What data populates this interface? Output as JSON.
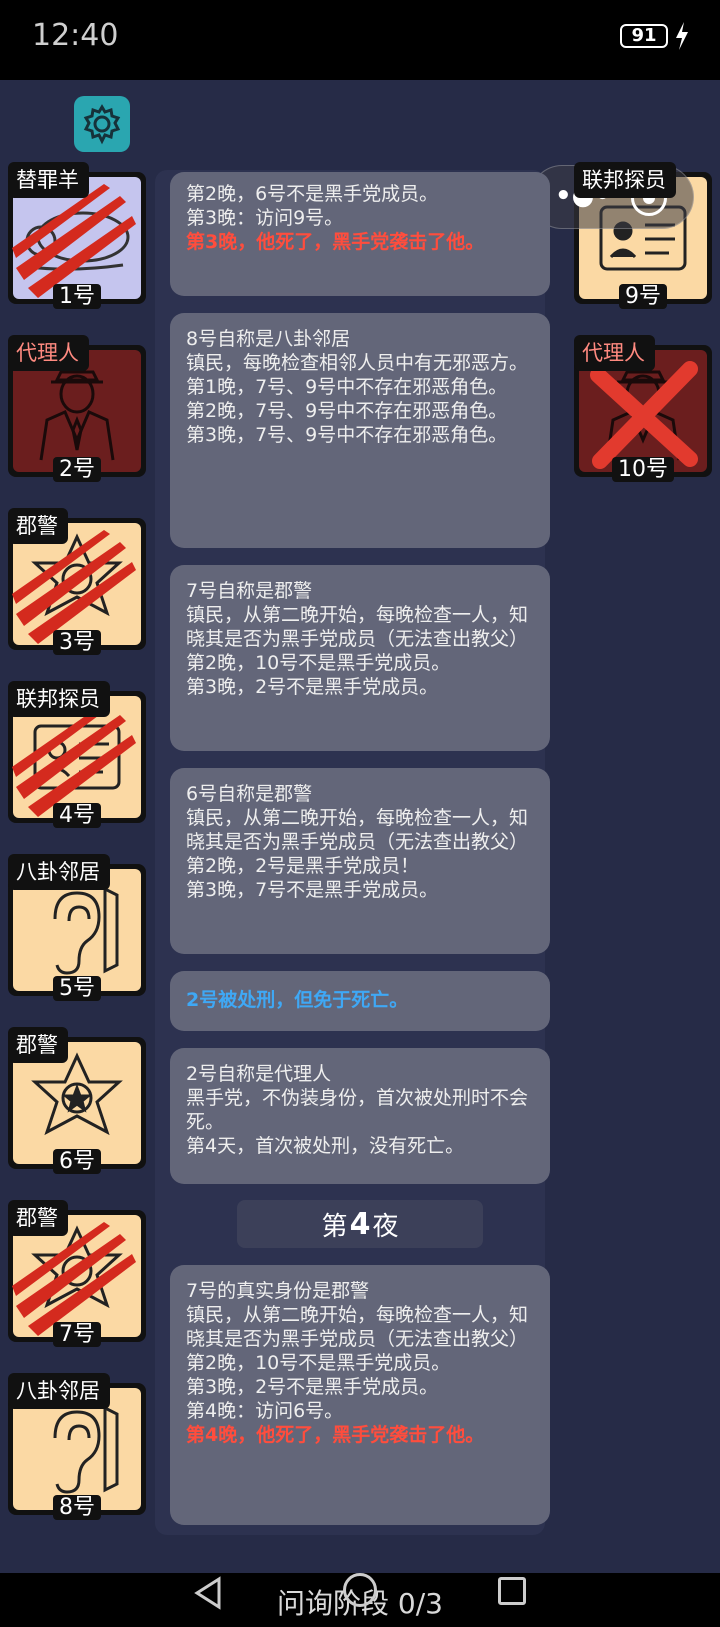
{
  "status": {
    "time": "12:40",
    "battery": "91"
  },
  "players": [
    {
      "role": "替罪羊",
      "num": "1号",
      "icon": "sleeping-sheep-icon",
      "evil": false,
      "dead": true,
      "face": "lilac"
    },
    {
      "role": "代理人",
      "num": "2号",
      "icon": "agent-suit-icon",
      "evil": true,
      "dead": false,
      "face": "dark"
    },
    {
      "role": "郡警",
      "num": "3号",
      "icon": "sheriff-badge-icon",
      "evil": false,
      "dead": true,
      "face": "light"
    },
    {
      "role": "联邦探员",
      "num": "4号",
      "icon": "fbi-card-icon",
      "evil": false,
      "dead": true,
      "face": "light"
    },
    {
      "role": "八卦邻居",
      "num": "5号",
      "icon": "ear-icon",
      "evil": false,
      "dead": false,
      "face": "light"
    },
    {
      "role": "郡警",
      "num": "6号",
      "icon": "sheriff-badge-icon",
      "evil": false,
      "dead": false,
      "face": "light"
    },
    {
      "role": "郡警",
      "num": "7号",
      "icon": "sheriff-badge-icon",
      "evil": false,
      "dead": true,
      "face": "light"
    },
    {
      "role": "八卦邻居",
      "num": "8号",
      "icon": "ear-icon",
      "evil": false,
      "dead": false,
      "face": "light"
    },
    {
      "role": "联邦探员",
      "num": "9号",
      "icon": "fbi-card-icon",
      "evil": false,
      "dead": false,
      "face": "light"
    },
    {
      "role": "代理人",
      "num": "10号",
      "icon": "agent-suit-icon",
      "evil": true,
      "dead": true,
      "face": "dark"
    }
  ],
  "log": {
    "card1": {
      "lines": "第2晚，6号不是黑手党成员。\n第3晚：访问9号。",
      "death": "第3晚，他死了，黑手党袭击了他。"
    },
    "card2": {
      "lines": "8号自称是八卦邻居\n镇民，每晚检查相邻人员中有无邪恶方。\n第1晚，7号、9号中不存在邪恶角色。\n第2晚，7号、9号中不存在邪恶角色。\n第3晚，7号、9号中不存在邪恶角色。"
    },
    "card3": {
      "lines": "7号自称是郡警\n镇民，从第二晚开始，每晚检查一人，知晓其是否为黑手党成员（无法查出教父）\n第2晚，10号不是黑手党成员。\n第3晚，2号不是黑手党成员。"
    },
    "card4": {
      "lines": "6号自称是郡警\n镇民，从第二晚开始，每晚检查一人，知晓其是否为黑手党成员（无法查出教父）\n第2晚，2号是黑手党成员！\n第3晚，7号不是黑手党成员。"
    },
    "card5": {
      "info": "2号被处刑，但免于死亡。"
    },
    "card6": {
      "lines": "2号自称是代理人\n黑手党，不伪装身份，首次被处刑时不会死。\n第4天，首次被处刑，没有死亡。"
    },
    "night": {
      "prefix": "第",
      "num": "4",
      "suffix": "夜"
    },
    "card7": {
      "lines": "7号的真实身份是郡警\n镇民，从第二晚开始，每晚检查一人，知晓其是否为黑手党成员（无法查出教父）\n第2晚，10号不是黑手党成员。\n第3晚，2号不是黑手党成员。\n第4晚：访问6号。",
      "death": "第4晚，他死了，黑手党袭击了他。"
    }
  },
  "phase": "问询阶段 0/3",
  "colors": {
    "death_text": "#ff4d3d",
    "info_text": "#3fa8f5",
    "evil_role_tag": "#ff8a80",
    "settings_button": "#2aa6b0"
  }
}
